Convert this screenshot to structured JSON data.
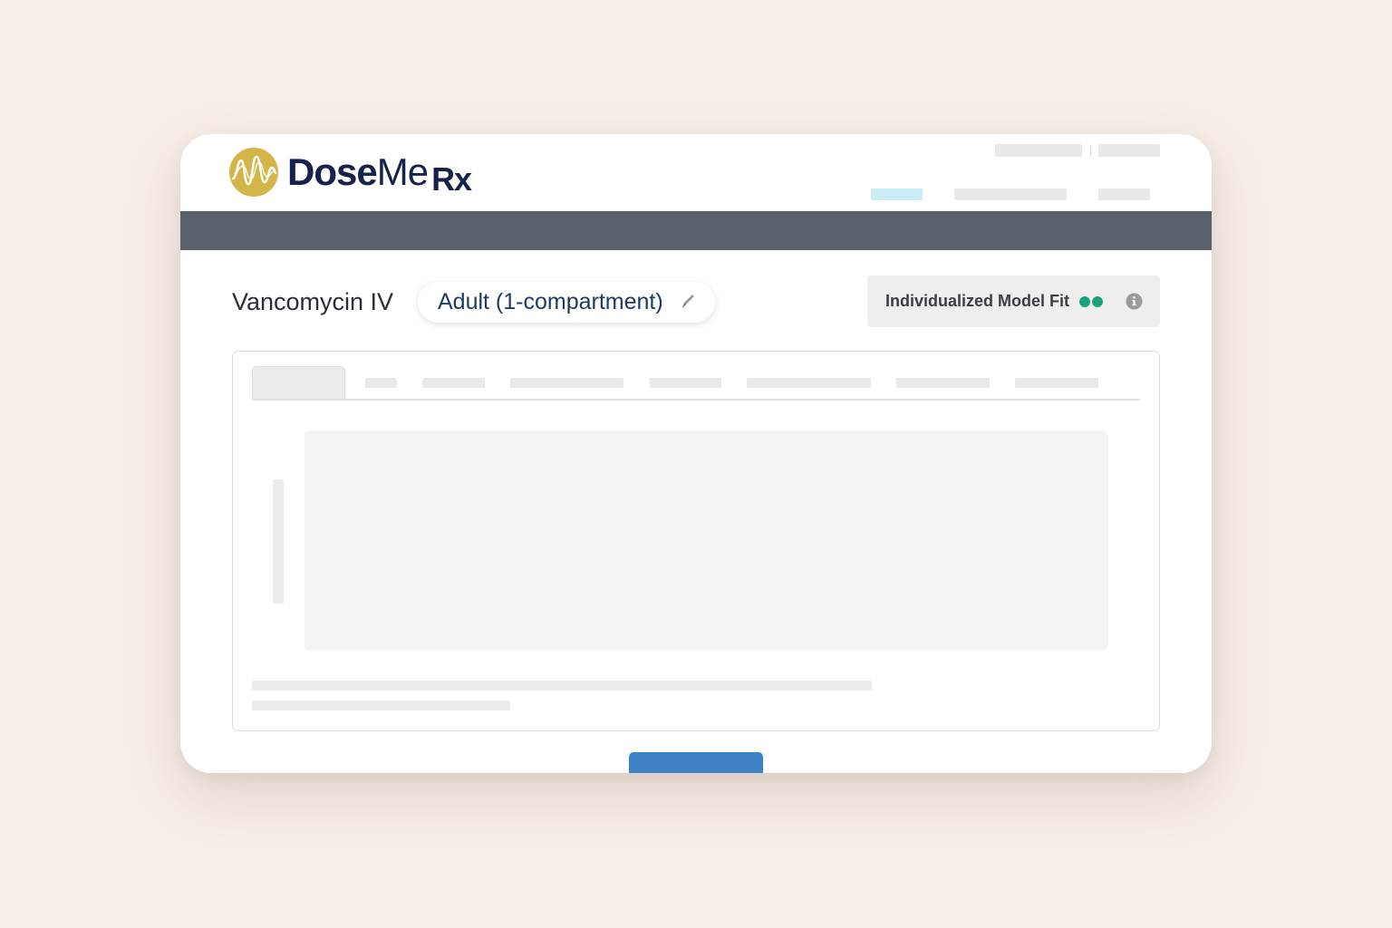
{
  "brand": {
    "name_part1": "Dose",
    "name_part2": "Me",
    "name_part3": "Rx",
    "logo_icon": "waveform-circle-icon",
    "logo_color": "#d4b54a",
    "text_color": "#16224a"
  },
  "page": {
    "drug_title": "Vancomycin IV",
    "model_label": "Adult (1-compartment)",
    "edit_icon": "pencil-icon"
  },
  "model_fit": {
    "label": "Individualized Model Fit",
    "status_color": "#1aa37a",
    "dot_count": 2,
    "info_icon": "info-icon"
  },
  "colors": {
    "background": "#f6eee8",
    "navbar": "#5a616b",
    "primary_button": "#3f82c4",
    "active_nav_placeholder": "#c9ecf7"
  }
}
